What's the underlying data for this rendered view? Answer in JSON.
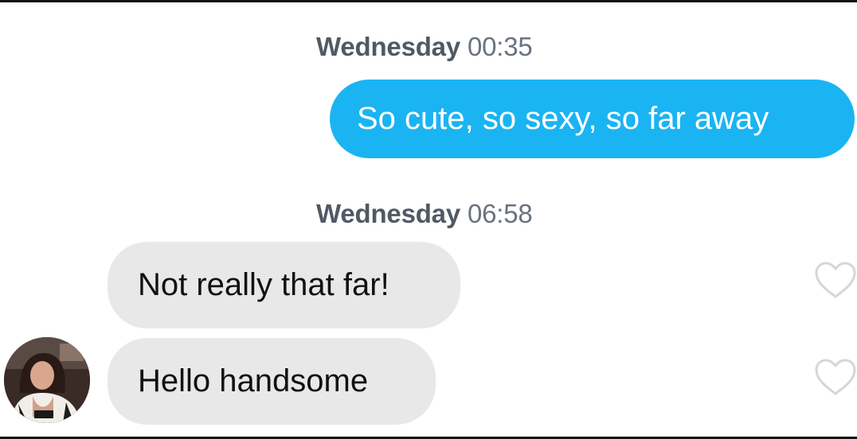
{
  "messages": [
    {
      "timestamp": {
        "day": "Wednesday",
        "time": "00:35"
      },
      "direction": "outgoing",
      "text": "So cute, so sexy, so far away"
    },
    {
      "timestamp": {
        "day": "Wednesday",
        "time": "06:58"
      },
      "direction": "incoming",
      "text": "Not really that far!",
      "like_icon": "heart-outline-icon"
    },
    {
      "direction": "incoming",
      "text": "Hello handsome",
      "like_icon": "heart-outline-icon",
      "sender_avatar": "avatar-photo"
    }
  ],
  "colors": {
    "outgoing_bubble": "#1ab4f2",
    "incoming_bubble": "#e8e8e8",
    "timestamp_text": "#505965",
    "heart_outline": "#d6d6d6"
  }
}
